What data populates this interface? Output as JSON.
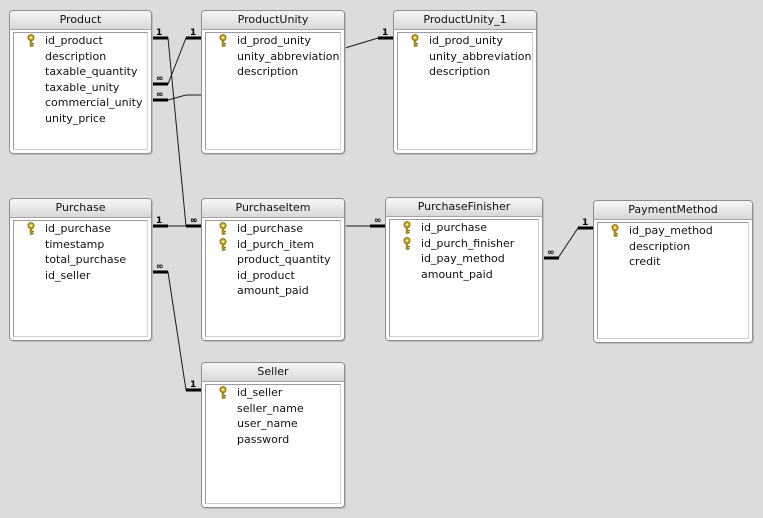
{
  "tables": [
    {
      "id": "product",
      "title": "Product",
      "fields": [
        {
          "name": "id_product",
          "key": true
        },
        {
          "name": "description",
          "key": false
        },
        {
          "name": "taxable_quantity",
          "key": false
        },
        {
          "name": "taxable_unity",
          "key": false
        },
        {
          "name": "commercial_unity",
          "key": false
        },
        {
          "name": "unity_price",
          "key": false
        }
      ]
    },
    {
      "id": "productunity",
      "title": "ProductUnity",
      "fields": [
        {
          "name": "id_prod_unity",
          "key": true
        },
        {
          "name": "unity_abbreviation",
          "key": false
        },
        {
          "name": "description",
          "key": false
        }
      ]
    },
    {
      "id": "productunity1",
      "title": "ProductUnity_1",
      "fields": [
        {
          "name": "id_prod_unity",
          "key": true
        },
        {
          "name": "unity_abbreviation",
          "key": false
        },
        {
          "name": "description",
          "key": false
        }
      ]
    },
    {
      "id": "purchase",
      "title": "Purchase",
      "fields": [
        {
          "name": "id_purchase",
          "key": true
        },
        {
          "name": "timestamp",
          "key": false
        },
        {
          "name": "total_purchase",
          "key": false
        },
        {
          "name": "id_seller",
          "key": false
        }
      ]
    },
    {
      "id": "purchaseitem",
      "title": "PurchaseItem",
      "fields": [
        {
          "name": "id_purchase",
          "key": true
        },
        {
          "name": "id_purch_item",
          "key": true
        },
        {
          "name": "product_quantity",
          "key": false
        },
        {
          "name": "id_product",
          "key": false
        },
        {
          "name": "amount_paid",
          "key": false
        }
      ]
    },
    {
      "id": "purchasefinisher",
      "title": "PurchaseFinisher",
      "fields": [
        {
          "name": "id_purchase",
          "key": true
        },
        {
          "name": "id_purch_finisher",
          "key": true
        },
        {
          "name": "id_pay_method",
          "key": false
        },
        {
          "name": "amount_paid",
          "key": false
        }
      ]
    },
    {
      "id": "paymentmethod",
      "title": "PaymentMethod",
      "fields": [
        {
          "name": "id_pay_method",
          "key": true
        },
        {
          "name": "description",
          "key": false
        },
        {
          "name": "credit",
          "key": false
        }
      ]
    },
    {
      "id": "seller",
      "title": "Seller",
      "fields": [
        {
          "name": "id_seller",
          "key": true
        },
        {
          "name": "seller_name",
          "key": false
        },
        {
          "name": "user_name",
          "key": false
        },
        {
          "name": "password",
          "key": false
        }
      ]
    }
  ],
  "relationships": [
    {
      "id": "product-purchaseitem",
      "one": "1",
      "many": "∞"
    },
    {
      "id": "productunity-taxable",
      "one": "1",
      "many": "∞"
    },
    {
      "id": "productunity-commercial",
      "one": "",
      "many": "∞"
    },
    {
      "id": "productunity-productunity1",
      "one": "1",
      "many": ""
    },
    {
      "id": "purchase-purchaseitem",
      "one": "1",
      "many": "∞"
    },
    {
      "id": "purchase-seller",
      "one": "1",
      "many": "∞"
    },
    {
      "id": "purchaseitem-purchasefinisher",
      "one": "",
      "many": "∞"
    },
    {
      "id": "paymentmethod-purchasefinisher",
      "one": "1",
      "many": "∞"
    }
  ]
}
